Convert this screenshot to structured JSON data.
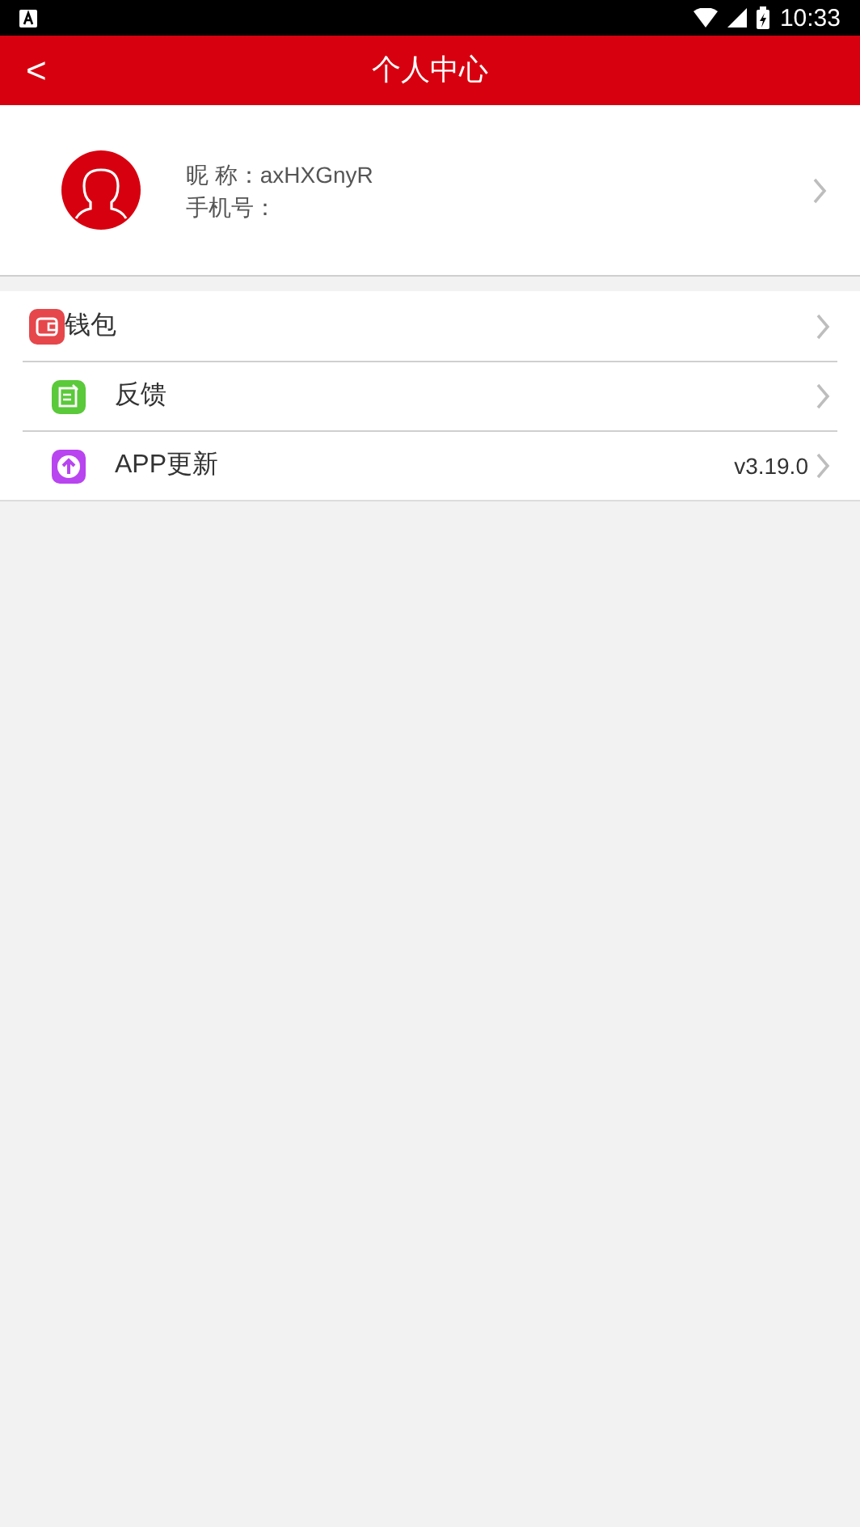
{
  "status_bar": {
    "time": "10:33"
  },
  "header": {
    "back": "<",
    "title": "个人中心"
  },
  "profile": {
    "nickname_label": "昵 称：",
    "nickname": "axHXGnyR",
    "phone_label": "手机号："
  },
  "menu": [
    {
      "kind": "wallet",
      "label": "钱包"
    },
    {
      "kind": "feedback",
      "label": "反馈"
    },
    {
      "kind": "update",
      "label": "APP更新",
      "value": "v3.19.0"
    }
  ]
}
